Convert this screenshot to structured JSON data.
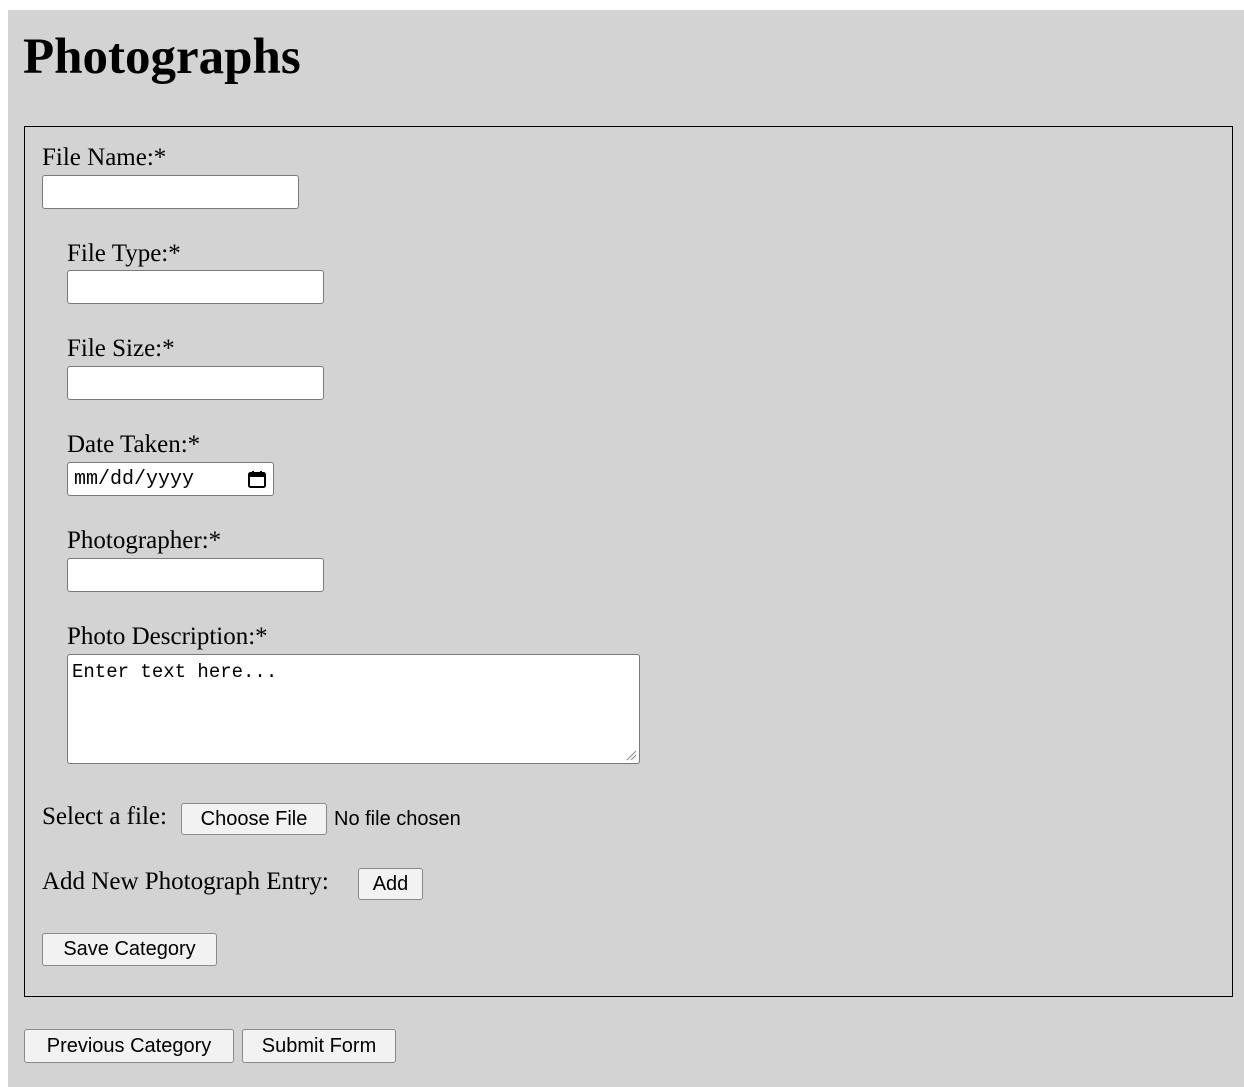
{
  "page": {
    "title": "Photographs",
    "background": "#d3d3d3"
  },
  "form": {
    "file_name_label": "File Name:*",
    "file_name_value": "",
    "file_type_label": "File Type:*",
    "file_type_value": "",
    "file_size_label": "File Size:*",
    "file_size_value": "",
    "date_taken_label": "Date Taken:*",
    "date_taken_placeholder": "mm/dd/yyyy",
    "photographer_label": "Photographer:*",
    "photographer_value": "",
    "description_label": "Photo Description:*",
    "description_value": "Enter text here...",
    "select_file_label": "Select a file:",
    "choose_file_button": "Choose File",
    "no_file_text": "No file chosen",
    "add_entry_label": "Add New Photograph Entry:",
    "add_button": "Add",
    "save_category_button": "Save Category"
  },
  "footer": {
    "previous_button": "Previous Category",
    "submit_button": "Submit Form"
  },
  "icons": {
    "date_picker": "calendar-icon",
    "textarea_resize": "resize-handle-icon"
  }
}
